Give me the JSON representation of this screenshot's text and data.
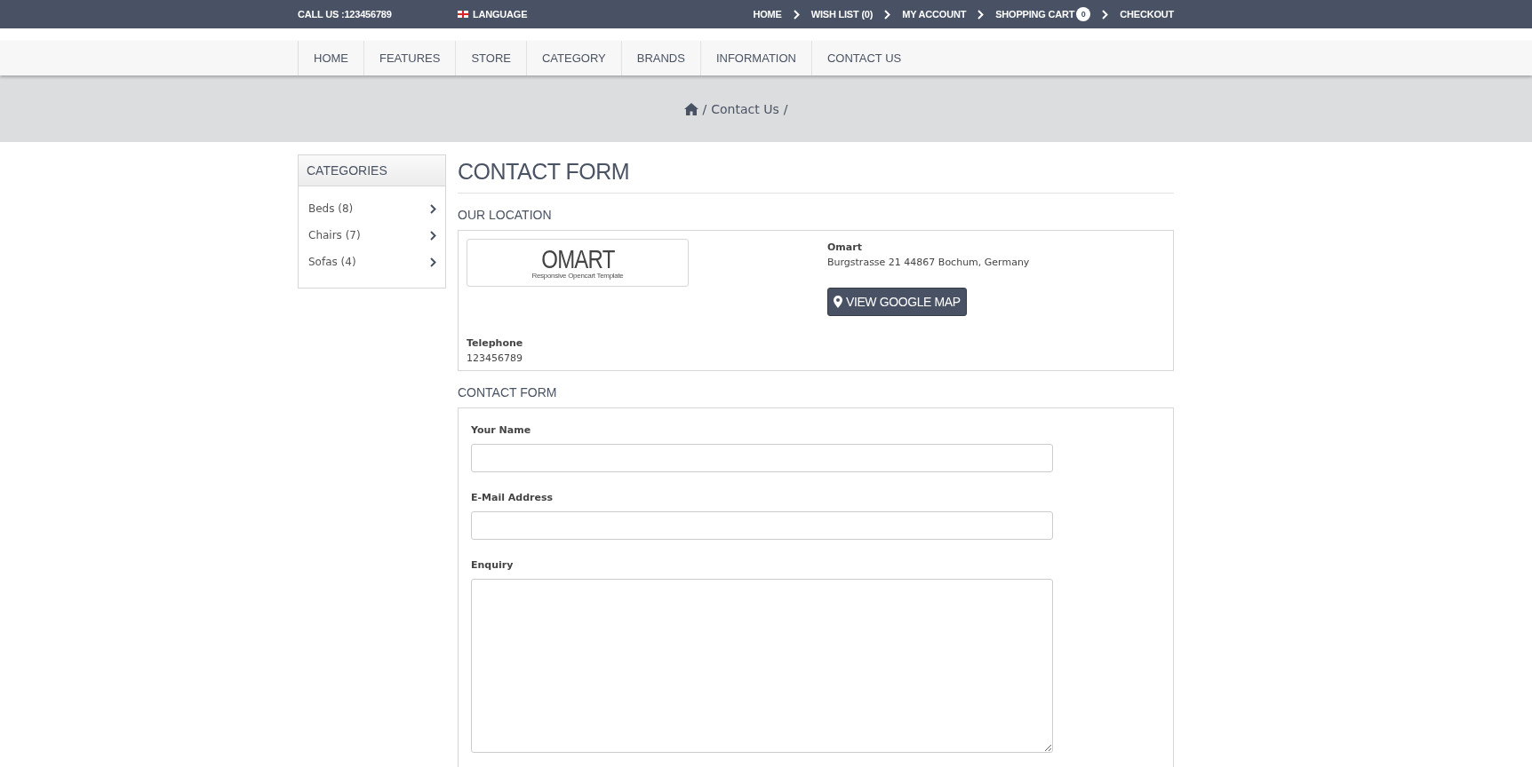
{
  "top_bar": {
    "call_us": "CALL US :123456789",
    "language": "LANGUAGE",
    "links": [
      {
        "label": "HOME"
      },
      {
        "label": "WISH LIST (0)"
      },
      {
        "label": "MY ACCOUNT"
      },
      {
        "label": "SHOPPING CART",
        "badge": "0"
      },
      {
        "label": "CHECKOUT"
      }
    ]
  },
  "nav": [
    {
      "label": "HOME"
    },
    {
      "label": "FEATURES"
    },
    {
      "label": "STORE"
    },
    {
      "label": "CATEGORY"
    },
    {
      "label": "BRANDS"
    },
    {
      "label": "INFORMATION"
    },
    {
      "label": "CONTACT US"
    }
  ],
  "breadcrumb": {
    "separator": "/",
    "items": [
      {
        "label": "Contact Us"
      }
    ]
  },
  "sidebar": {
    "title": "CATEGORIES",
    "items": [
      {
        "label": "Beds (8)"
      },
      {
        "label": "Chairs (7)"
      },
      {
        "label": "Sofas (4)"
      }
    ]
  },
  "content": {
    "title": "CONTACT FORM",
    "location": {
      "heading": "OUR LOCATION",
      "logo": {
        "name": "OMART",
        "tagline": "Responsive Opencart Template"
      },
      "store_name": "Omart",
      "address": "Burgstrasse 21 44867 Bochum, Germany",
      "map_button": "VIEW GOOGLE MAP",
      "telephone_label": "Telephone",
      "telephone": "123456789"
    },
    "form": {
      "heading": "CONTACT FORM",
      "fields": [
        {
          "kind": "text",
          "label": "Your Name"
        },
        {
          "kind": "text",
          "label": "E-Mail Address"
        },
        {
          "kind": "textarea",
          "label": "Enquiry"
        }
      ]
    }
  }
}
